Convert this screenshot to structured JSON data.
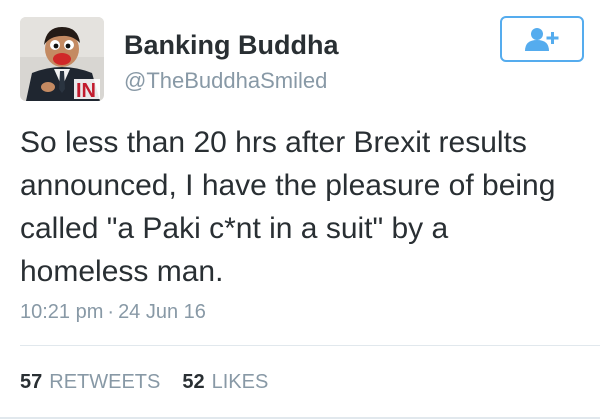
{
  "tweet": {
    "user": {
      "display_name": "Banking Buddha",
      "handle": "@TheBuddhaSmiled"
    },
    "text_lines": [
      "So less than 20 hrs after Brexit results",
      "announced, I have the pleasure of being",
      "called \"a Paki c*nt in a suit\" by a",
      "homeless man."
    ],
    "time": "10:21 pm",
    "separator": "·",
    "date": "24 Jun 16",
    "retweets_count": "57",
    "retweets_label": "RETWEETS",
    "likes_count": "52",
    "likes_label": "LIKES"
  },
  "colors": {
    "accent": "#55acee",
    "text": "#292f33",
    "muted": "#8899a6",
    "divider": "#e1e8ed"
  },
  "icons": {
    "follow": "add-user-icon"
  }
}
